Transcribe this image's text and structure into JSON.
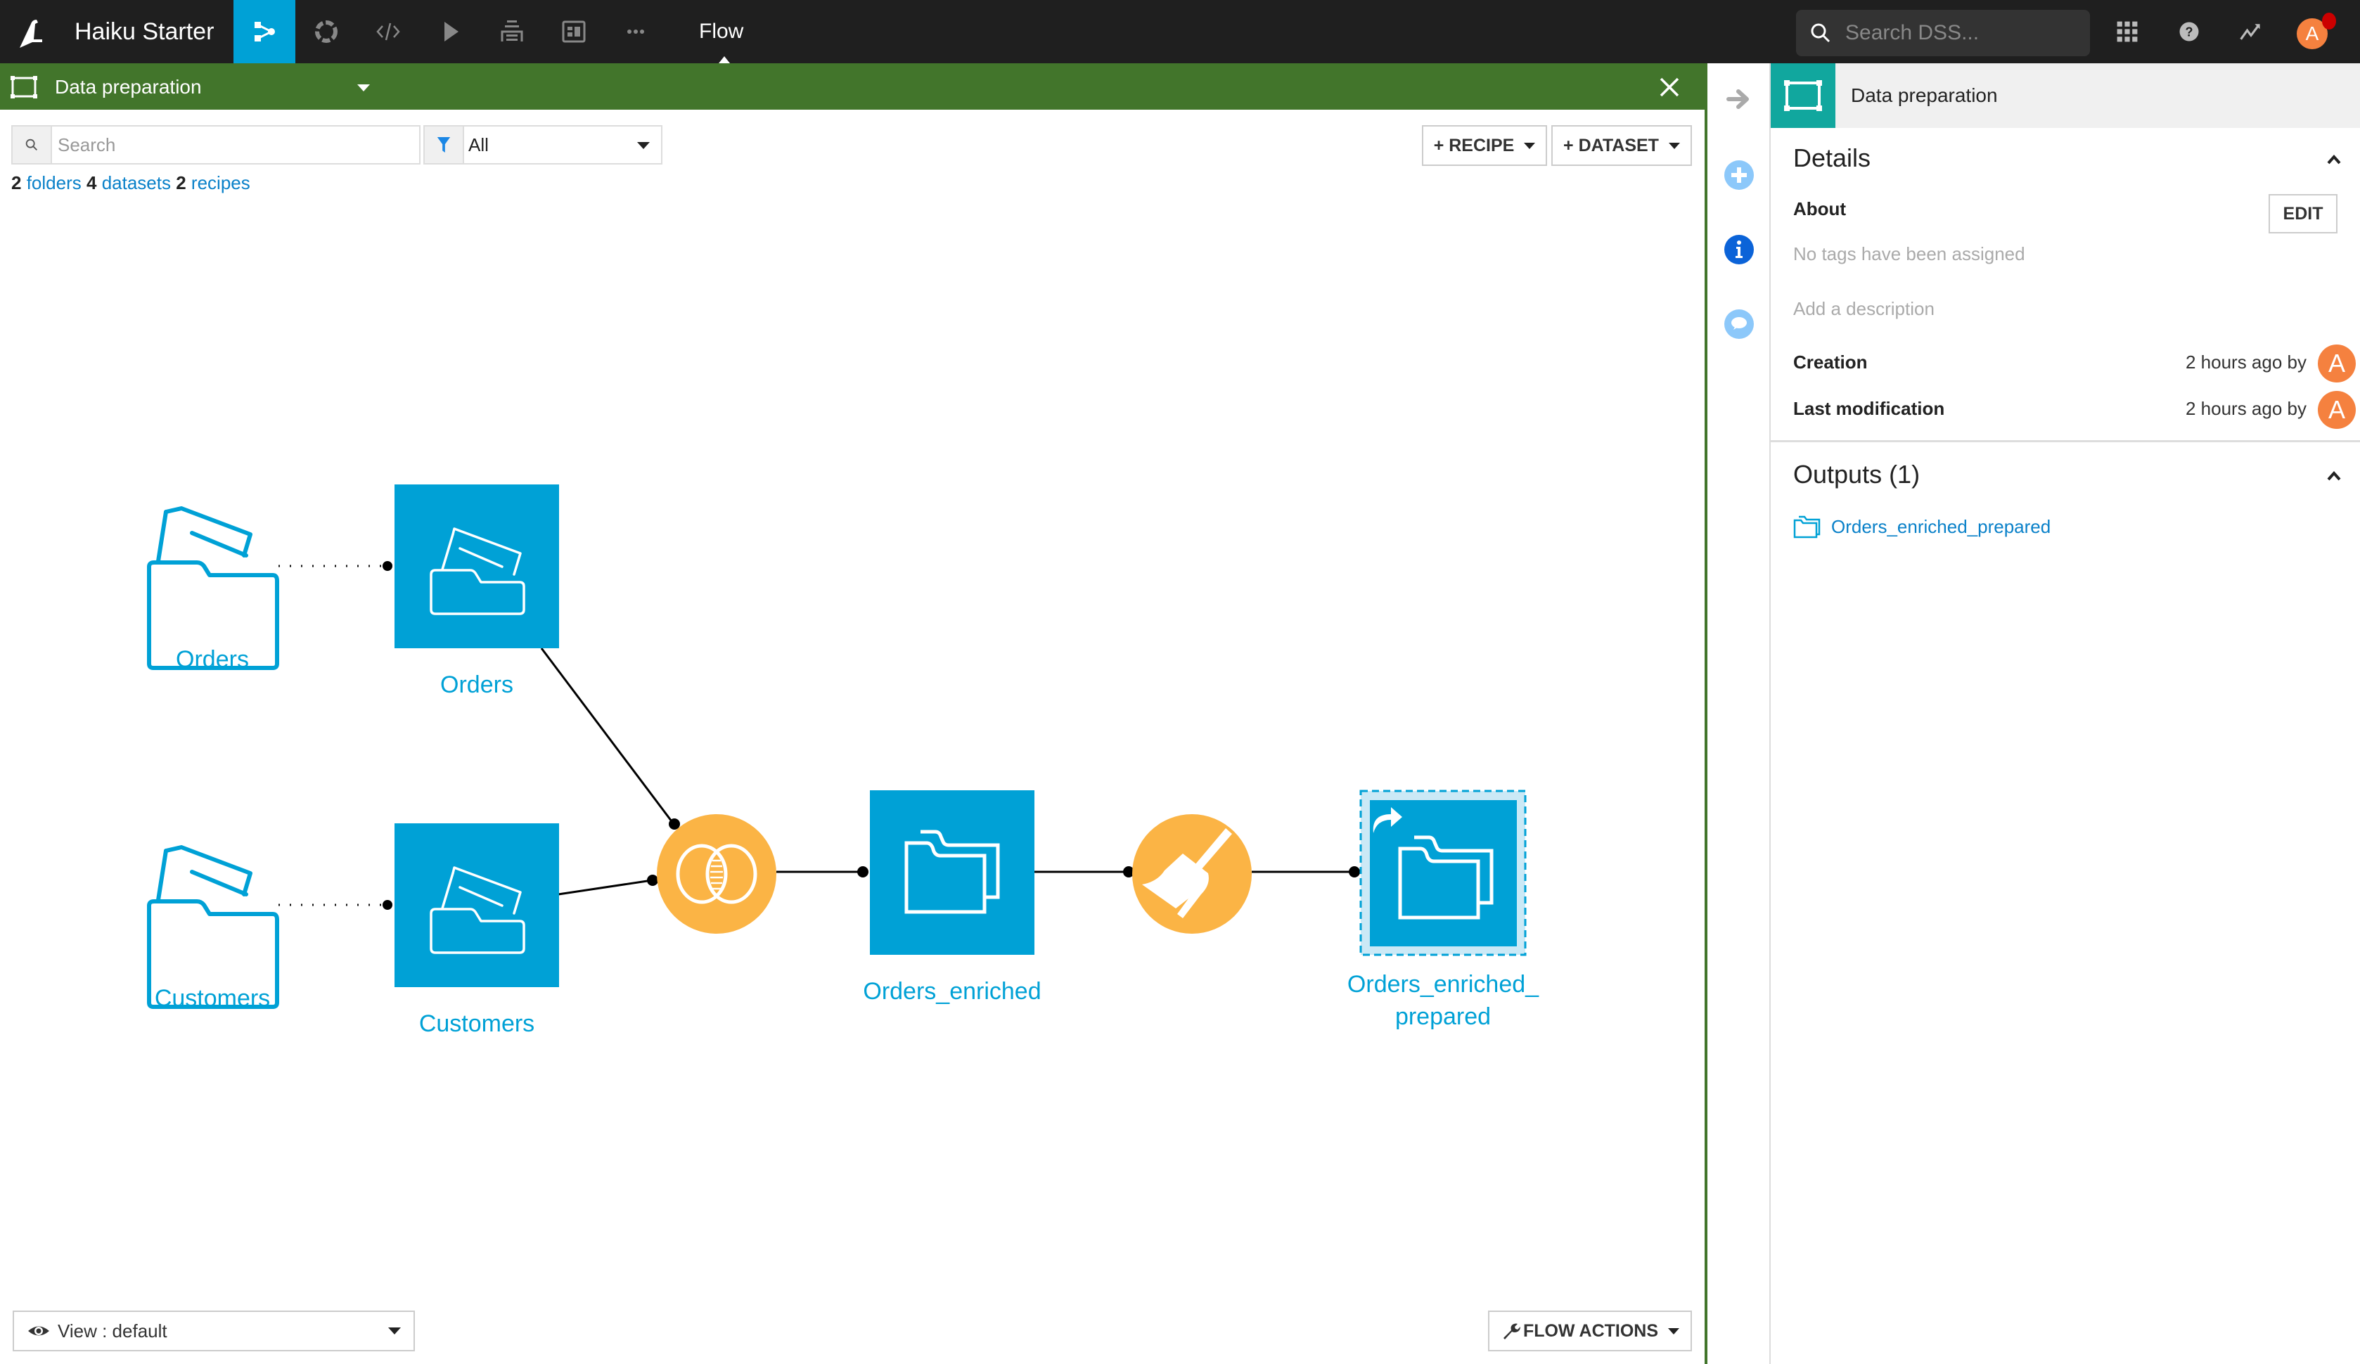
{
  "topbar": {
    "project_title": "Haiku Starter",
    "section_label": "Flow",
    "nav_icons": [
      "flow-icon",
      "lab-icon",
      "code-icon",
      "run-icon",
      "deploy-icon",
      "dashboard-icon",
      "more-icon"
    ],
    "search_placeholder": "Search DSS...",
    "user_initial": "A",
    "right_icons": [
      "apps-grid-icon",
      "help-icon",
      "activity-icon"
    ]
  },
  "zone": {
    "name": "Data preparation"
  },
  "toolbar": {
    "search_placeholder": "Search",
    "filter_value": "All",
    "recipe_button": "+ RECIPE",
    "dataset_button": "+ DATASET"
  },
  "counts": {
    "folders_count": "2",
    "folders_label": "folders",
    "datasets_count": "4",
    "datasets_label": "datasets",
    "recipes_count": "2",
    "recipes_label": "recipes"
  },
  "flow": {
    "nodes": [
      {
        "id": "orders-folder",
        "type": "shared-folder",
        "label": "Orders"
      },
      {
        "id": "orders-dataset",
        "type": "dataset",
        "label": "Orders"
      },
      {
        "id": "customers-folder",
        "type": "shared-folder",
        "label": "Customers"
      },
      {
        "id": "customers-dataset",
        "type": "dataset",
        "label": "Customers"
      },
      {
        "id": "join-recipe",
        "type": "recipe-join",
        "label": ""
      },
      {
        "id": "orders-enriched",
        "type": "dataset",
        "label": "Orders_enriched"
      },
      {
        "id": "prepare-recipe",
        "type": "recipe-prepare",
        "label": ""
      },
      {
        "id": "orders-enriched-prepared",
        "type": "dataset-shared-selected",
        "label_line1": "Orders_enriched_",
        "label_line2": "prepared"
      }
    ],
    "colors": {
      "dataset": "#00a1d6",
      "recipe": "#fbb445",
      "zone": "#42752b"
    }
  },
  "bottom": {
    "view_select": "View : default",
    "flow_actions": "FLOW ACTIONS"
  },
  "right_panel": {
    "title": "Data preparation",
    "details_title": "Details",
    "about_label": "About",
    "edit_button": "EDIT",
    "no_tags": "No tags have been assigned",
    "add_description": "Add a description",
    "creation_label": "Creation",
    "creation_value": "2 hours ago by",
    "last_mod_label": "Last modification",
    "last_mod_value": "2 hours ago by",
    "creator_initial": "A",
    "modifier_initial": "A",
    "outputs_title": "Outputs (1)",
    "outputs": [
      "Orders_enriched_prepared"
    ]
  }
}
